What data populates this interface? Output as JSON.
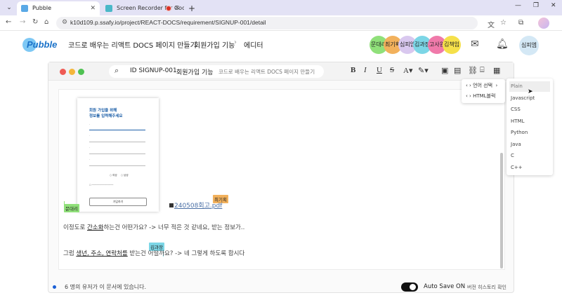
{
  "browser": {
    "tabs": [
      {
        "title": "Pubble",
        "active": true
      },
      {
        "title": "Screen Recorder for Google",
        "active": false
      }
    ],
    "url": "k10d109.p.ssafy.io/project/REACT-DOCS/requirement/SIGNUP-001/detail"
  },
  "header": {
    "logo_text": "Pubble",
    "breadcrumb": [
      "코드로 배우는 리액트 DOCS 페이지 만들기",
      "회원가입 기능",
      "에디터"
    ],
    "online_users": [
      {
        "name": "문대리",
        "color": "#90e07a"
      },
      {
        "name": "최기획",
        "color": "#f2b15c"
      },
      {
        "name": "심피엠",
        "color": "#d9c8ef"
      },
      {
        "name": "김과장",
        "color": "#7cd6e6"
      },
      {
        "name": "고사원",
        "color": "#f07aaa"
      },
      {
        "name": "김책임",
        "color": "#f5e04a"
      }
    ],
    "me": "심피엠"
  },
  "editor": {
    "doc_id": "ID SIGNUP-001",
    "doc_name": "회원가입 기능",
    "project_name": "코드로 배우는 리액트 DOCS 페이지 만들기",
    "toolbar": [
      "B",
      "I",
      "U",
      "S"
    ],
    "mock_form": {
      "title": "회원 가입을 위해\n정보를 입력해주세요",
      "button": "가입하기",
      "radio_options": [
        "여성",
        "남성"
      ]
    },
    "attachment_name": "240508회고.pdf",
    "cursors": [
      {
        "name": "최기획",
        "color": "#f2b15c"
      },
      {
        "name": "문대리",
        "color": "#90e07a"
      },
      {
        "name": "김과장",
        "color": "#7cd6e6"
      }
    ],
    "paragraph1": {
      "before": "이정도로 ",
      "underlined": "간소화",
      "after": "하는건 어떤가요? -> 너무 적은 것 같네요, 받는 정보가.."
    },
    "paragraph2": {
      "before": "그럼 ",
      "underlined": "생년, 주소, 연락처를",
      "after": " 받는건 어떨까요? -> 네 그렇게 하도록 합시다"
    },
    "block_menu": {
      "items": [
        "언어 선택",
        "HTML블럭"
      ]
    },
    "language_menu": {
      "options": [
        "Plain",
        "Javascript",
        "CSS",
        "HTML",
        "Python",
        "Java",
        "C",
        "C++"
      ],
      "selected": "Plain"
    }
  },
  "footer": {
    "online_count_text": "6 명의 유저가 이 문서에 있습니다.",
    "autosave_label": "Auto Save ON",
    "autosave_on": true,
    "history_label": "버전 히스토리 확인"
  }
}
